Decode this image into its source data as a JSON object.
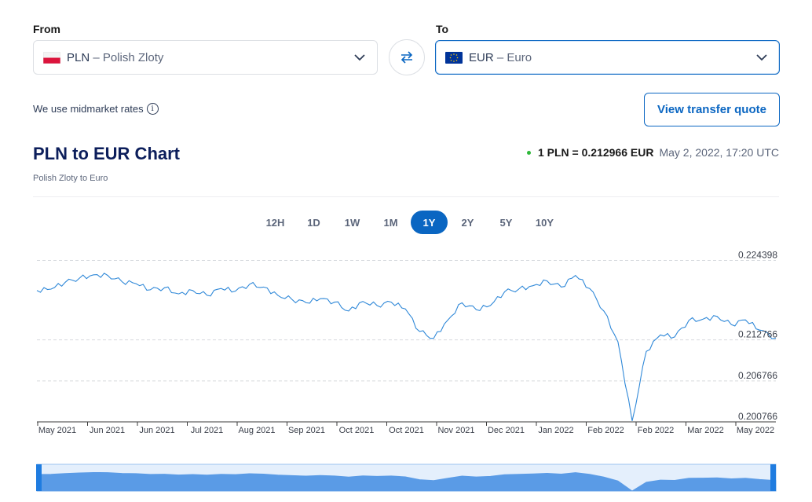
{
  "from": {
    "label": "From",
    "code": "PLN",
    "name": "Polish Zloty",
    "separator": "–",
    "flag_icon": "poland-flag-icon"
  },
  "to": {
    "label": "To",
    "code": "EUR",
    "name": "Euro",
    "separator": "–",
    "flag_icon": "eu-flag-icon"
  },
  "swap_icon": "swap-arrows-icon",
  "rates_note": "We use midmarket rates",
  "quote_button": "View transfer quote",
  "chart_header": {
    "title": "PLN to EUR Chart",
    "subtitle": "Polish Zloty to Euro",
    "rate_text": "1 PLN = 0.212966 EUR",
    "timestamp": "May 2, 2022, 17:20 UTC"
  },
  "ranges": [
    {
      "label": "12H",
      "selected": false
    },
    {
      "label": "1D",
      "selected": false
    },
    {
      "label": "1W",
      "selected": false
    },
    {
      "label": "1M",
      "selected": false
    },
    {
      "label": "1Y",
      "selected": true
    },
    {
      "label": "2Y",
      "selected": false
    },
    {
      "label": "5Y",
      "selected": false
    },
    {
      "label": "10Y",
      "selected": false
    }
  ],
  "colors": {
    "accent": "#0a66c2",
    "line": "#2f88d8",
    "navigator_fill": "#5a9be6",
    "live_dot": "#2eb83a"
  },
  "chart_data": {
    "type": "line",
    "title": "",
    "xlabel": "",
    "ylabel": "",
    "ylim": [
      0.200766,
      0.2263
    ],
    "y_ticks": [
      "0.224398",
      "0.212766",
      "0.206766",
      "0.200766"
    ],
    "x_ticks": [
      "May 2021",
      "Jun 2021",
      "Jun 2021",
      "Jul 2021",
      "Aug 2021",
      "Sep 2021",
      "Oct 2021",
      "Oct 2021",
      "Nov 2021",
      "Dec 2021",
      "Jan 2022",
      "Feb 2022",
      "Feb 2022",
      "Mar 2022",
      "May 2022"
    ],
    "x": [
      "2021-05-02",
      "2021-05-09",
      "2021-05-16",
      "2021-05-23",
      "2021-05-30",
      "2021-06-06",
      "2021-06-13",
      "2021-06-20",
      "2021-06-27",
      "2021-07-04",
      "2021-07-11",
      "2021-07-18",
      "2021-07-25",
      "2021-08-01",
      "2021-08-08",
      "2021-08-15",
      "2021-08-22",
      "2021-08-29",
      "2021-09-05",
      "2021-09-12",
      "2021-09-19",
      "2021-09-26",
      "2021-10-03",
      "2021-10-10",
      "2021-10-17",
      "2021-10-24",
      "2021-10-31",
      "2021-11-07",
      "2021-11-14",
      "2021-11-21",
      "2021-11-28",
      "2021-12-05",
      "2021-12-12",
      "2021-12-19",
      "2021-12-26",
      "2022-01-02",
      "2022-01-09",
      "2022-01-16",
      "2022-01-23",
      "2022-01-30",
      "2022-02-06",
      "2022-02-13",
      "2022-02-20",
      "2022-02-27",
      "2022-03-06",
      "2022-03-13",
      "2022-03-20",
      "2022-03-27",
      "2022-04-03",
      "2022-04-10",
      "2022-04-17",
      "2022-04-24",
      "2022-05-02"
    ],
    "series": [
      {
        "values": [
          0.22,
          0.2202,
          0.2212,
          0.2218,
          0.2223,
          0.2222,
          0.2213,
          0.221,
          0.2201,
          0.2204,
          0.2195,
          0.22,
          0.2193,
          0.2203,
          0.2199,
          0.2209,
          0.2205,
          0.2193,
          0.2187,
          0.2182,
          0.2188,
          0.2183,
          0.217,
          0.2184,
          0.2178,
          0.2183,
          0.2173,
          0.214,
          0.213,
          0.2157,
          0.2182,
          0.2172,
          0.2178,
          0.2198,
          0.2202,
          0.2207,
          0.2214,
          0.2205,
          0.2222,
          0.2203,
          0.217,
          0.2125,
          0.2009,
          0.2111,
          0.2135,
          0.2132,
          0.2156,
          0.2158,
          0.2162,
          0.215,
          0.2157,
          0.2142,
          0.213
        ]
      }
    ],
    "legend": "none",
    "grid": "dashed horizontal lines"
  }
}
